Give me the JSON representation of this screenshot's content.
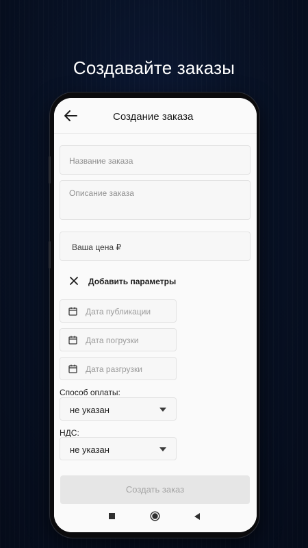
{
  "promo": {
    "headline": "Создавайте заказы"
  },
  "appbar": {
    "title": "Создание заказа",
    "back_icon": "arrow-left-icon"
  },
  "form": {
    "name_placeholder": "Название заказа",
    "description_placeholder": "Описание заказа",
    "price_placeholder": "Ваша цена ₽",
    "params_toggle_label": "Добавить параметры",
    "dates": [
      {
        "label": "Дата публикации",
        "icon": "calendar-icon"
      },
      {
        "label": "Дата погрузки",
        "icon": "calendar-icon"
      },
      {
        "label": "Дата разгрузки",
        "icon": "calendar-icon"
      }
    ],
    "payment": {
      "label": "Способ оплаты:",
      "value": "не указан"
    },
    "vat": {
      "label": "НДС:",
      "value": "не указан"
    },
    "submit_label": "Создать заказ"
  },
  "colors": {
    "background": "#081226",
    "screen": "#fafafa",
    "button_disabled": "#e6e6e6"
  }
}
